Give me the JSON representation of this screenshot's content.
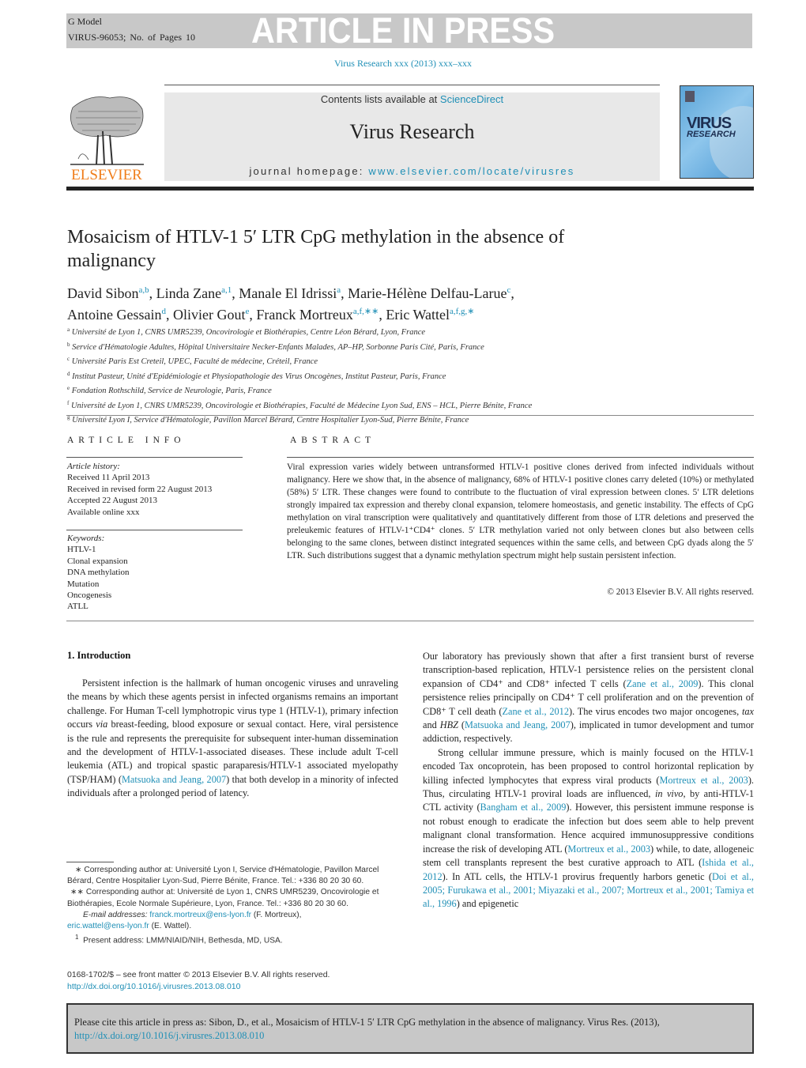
{
  "banner": {
    "model": "G Model",
    "article_id": "VIRUS-96053;",
    "pages": "No. of Pages 10",
    "status": "ARTICLE IN PRESS"
  },
  "journal_citation": "Virus Research xxx (2013) xxx–xxx",
  "header": {
    "publisher": "ELSEVIER",
    "contents_prefix": "Contents lists available at ",
    "contents_link": "ScienceDirect",
    "journal_name": "Virus Research",
    "homepage_prefix": "journal homepage: ",
    "homepage_link": "www.elsevier.com/locate/virusres",
    "cover_title": "VIRUS",
    "cover_subtitle": "RESEARCH"
  },
  "article": {
    "title": "Mosaicism of HTLV-1 5′ LTR CpG methylation in the absence of malignancy",
    "authors": [
      {
        "name": "David Sibon",
        "sup": "a,b",
        "sep": ", "
      },
      {
        "name": "Linda Zane",
        "sup": "a,1",
        "sep": ", "
      },
      {
        "name": "Manale El Idrissi",
        "sup": "a",
        "sep": ", "
      },
      {
        "name": "Marie-Hélène Delfau-Larue",
        "sup": "c",
        "sep": ","
      },
      {
        "name": "Antoine Gessain",
        "sup": "d",
        "sep": ", "
      },
      {
        "name": "Olivier Gout",
        "sup": "e",
        "sep": ", "
      },
      {
        "name": "Franck Mortreux",
        "sup": "a,f,∗∗",
        "sep": ", "
      },
      {
        "name": "Eric Wattel",
        "sup": "a,f,g,∗",
        "sep": ""
      }
    ],
    "affiliations": [
      {
        "key": "a",
        "text": "Université de Lyon 1, CNRS UMR5239, Oncovirologie et Biothérapies, Centre Léon Bérard, Lyon, France"
      },
      {
        "key": "b",
        "text": "Service d'Hématologie Adultes, Hôpital Universitaire Necker-Enfants Malades, AP–HP, Sorbonne Paris Cité, Paris, France"
      },
      {
        "key": "c",
        "text": "Université Paris Est Creteil, UPEC, Faculté de médecine, Créteil, France"
      },
      {
        "key": "d",
        "text": "Institut Pasteur, Unité d'Epidémiologie et Physiopathologie des Virus Oncogènes, Institut Pasteur, Paris, France"
      },
      {
        "key": "e",
        "text": "Fondation Rothschild, Service de Neurologie, Paris, France"
      },
      {
        "key": "f",
        "text": "Université de Lyon 1, CNRS UMR5239, Oncovirologie et Biothérapies, Faculté de Médecine Lyon Sud, ENS – HCL, Pierre Bénite, France"
      },
      {
        "key": "g",
        "text": "Université Lyon I, Service d'Hématologie, Pavillon Marcel Bérard, Centre Hospitalier Lyon-Sud, Pierre Bénite, France"
      }
    ]
  },
  "article_info": {
    "heading": "ARTICLE INFO",
    "history_label": "Article history:",
    "history": [
      "Received 11 April 2013",
      "Received in revised form 22 August 2013",
      "Accepted 22 August 2013",
      "Available online xxx"
    ],
    "keywords_label": "Keywords:",
    "keywords": [
      "HTLV-1",
      "Clonal expansion",
      "DNA methylation",
      "Mutation",
      "Oncogenesis",
      "ATLL"
    ]
  },
  "abstract": {
    "heading": "ABSTRACT",
    "text": "Viral expression varies widely between untransformed HTLV-1 positive clones derived from infected individuals without malignancy. Here we show that, in the absence of malignancy, 68% of HTLV-1 positive clones carry deleted (10%) or methylated (58%) 5′ LTR. These changes were found to contribute to the fluctuation of viral expression between clones. 5′ LTR deletions strongly impaired tax expression and thereby clonal expansion, telomere homeostasis, and genetic instability. The effects of CpG methylation on viral transcription were qualitatively and quantitatively different from those of LTR deletions and preserved the preleukemic features of HTLV-1⁺CD4⁺ clones. 5′ LTR methylation varied not only between clones but also between cells belonging to the same clones, between distinct integrated sequences within the same cells, and between CpG dyads along the 5′ LTR. Such distributions suggest that a dynamic methylation spectrum might help sustain persistent infection.",
    "copyright": "© 2013 Elsevier B.V. All rights reserved."
  },
  "introduction": {
    "heading": "1.  Introduction",
    "col1": [
      {
        "t": "Persistent infection is the hallmark of human oncogenic viruses and unraveling the means by which these agents persist in infected organisms remains an important challenge. For Human T-cell lymphotropic virus type 1 (HTLV-1), primary infection occurs "
      },
      {
        "t": "via",
        "i": true
      },
      {
        "t": " breast-feeding, blood exposure or sexual contact. Here, viral persistence is the rule and represents the prerequisite for subsequent inter-human dissemination and the development of HTLV-1-associated diseases. These include adult T-cell leukemia (ATL) and tropical spastic paraparesis/HTLV-1 associated myelopathy (TSP/HAM) ("
      },
      {
        "t": "Matsuoka and Jeang, 2007",
        "l": true
      },
      {
        "t": ") that both develop in a minority of infected individuals after a prolonged period of latency."
      }
    ],
    "col2_p1": [
      {
        "t": "Our laboratory has previously shown that after a first transient burst of reverse transcription-based replication, HTLV-1 persistence relies on the persistent clonal expansion of CD4⁺ and CD8⁺ infected T cells ("
      },
      {
        "t": "Zane et al., 2009",
        "l": true
      },
      {
        "t": "). This clonal persistence relies principally on CD4⁺ T cell proliferation and on the prevention of CD8⁺ T cell death ("
      },
      {
        "t": "Zane et al., 2012",
        "l": true
      },
      {
        "t": "). The virus encodes two major oncogenes, "
      },
      {
        "t": "tax",
        "i": true
      },
      {
        "t": " and "
      },
      {
        "t": "HBZ",
        "i": true
      },
      {
        "t": " ("
      },
      {
        "t": "Matsuoka and Jeang, 2007",
        "l": true
      },
      {
        "t": "), implicated in tumor development and tumor addiction, respectively."
      }
    ],
    "col2_p2": [
      {
        "t": "Strong cellular immune pressure, which is mainly focused on the HTLV-1 encoded Tax oncoprotein, has been proposed to control horizontal replication by killing infected lymphocytes that express viral products ("
      },
      {
        "t": "Mortreux et al., 2003",
        "l": true
      },
      {
        "t": "). Thus, circulating HTLV-1 proviral loads are influenced, "
      },
      {
        "t": "in vivo",
        "i": true
      },
      {
        "t": ", by anti-HTLV-1 CTL activity ("
      },
      {
        "t": "Bangham et al., 2009",
        "l": true
      },
      {
        "t": "). However, this persistent immune response is not robust enough to eradicate the infection but does seem able to help prevent malignant clonal transformation. Hence acquired immunosuppressive conditions increase the risk of developing ATL ("
      },
      {
        "t": "Mortreux et al., 2003",
        "l": true
      },
      {
        "t": ") while, to date, allogeneic stem cell transplants represent the best curative approach to ATL ("
      },
      {
        "t": "Ishida et al., 2012",
        "l": true
      },
      {
        "t": "). In ATL cells, the HTLV-1 provirus frequently harbors genetic ("
      },
      {
        "t": "Doi et al., 2005; Furukawa et al., 2001; Miyazaki et al., 2007; Mortreux et al., 2001; Tamiya et al., 1996",
        "l": true
      },
      {
        "t": ") and epigenetic"
      }
    ]
  },
  "footnotes": {
    "fn1": "∗  Corresponding author at: Université Lyon I, Service d'Hématologie, Pavillon Marcel Bérard, Centre Hospitalier Lyon-Sud, Pierre Bénite, France. Tel.: +336 80 20 30 60.",
    "fn2": "∗∗  Corresponding author at: Université de Lyon 1, CNRS UMR5239, Oncovirologie et Biothérapies, Ecole Normale Supérieure, Lyon, France. Tel.: +336 80 20 30 60.",
    "email_label": "E-mail addresses:",
    "email1": "franck.mortreux@ens-lyon.fr",
    "email1_name": " (F. Mortreux),",
    "email2": "eric.wattel@ens-lyon.fr",
    "email2_name": " (E. Wattel).",
    "fn3_mark": "1",
    "fn3": "Present address: LMM/NIAID/NIH, Bethesda, MD, USA."
  },
  "front_matter": {
    "issn_line": "0168-1702/$ – see front matter © 2013 Elsevier B.V. All rights reserved.",
    "doi": "http://dx.doi.org/10.1016/j.virusres.2013.08.010"
  },
  "cite_box": {
    "text": "Please cite this article in press as: Sibon, D., et al., Mosaicism of HTLV-1 5′ LTR CpG methylation in the absence of malignancy. Virus Res. (2013),",
    "doi": "http://dx.doi.org/10.1016/j.virusres.2013.08.010"
  },
  "colors": {
    "link": "#1f8fb6",
    "publisher_orange": "#f07d1a",
    "banner_gray": "#c8c8c8"
  }
}
